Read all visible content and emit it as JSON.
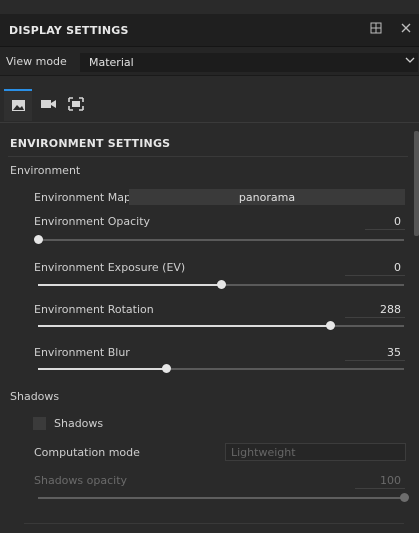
{
  "panel": {
    "title": "DISPLAY SETTINGS"
  },
  "header_icons": [
    "dock-icon",
    "close-icon"
  ],
  "view_mode": {
    "label": "View mode",
    "value": "Material"
  },
  "tabs": [
    {
      "name": "image-icon",
      "active": true
    },
    {
      "name": "video-camera-icon",
      "active": false
    },
    {
      "name": "frame-icon",
      "active": false
    }
  ],
  "environment_settings": {
    "title": "ENVIRONMENT SETTINGS",
    "group_label": "Environment",
    "env_map": {
      "label": "Environment Map",
      "value": "panorama"
    },
    "opacity": {
      "label": "Environment Opacity",
      "value": "0",
      "level": 0.0
    },
    "exposure": {
      "label": "Environment Exposure (EV)",
      "value": "0",
      "level": 0.5
    },
    "rotation": {
      "label": "Environment Rotation",
      "value": "288",
      "level": 0.8
    },
    "blur": {
      "label": "Environment Blur",
      "value": "35",
      "level": 0.35
    }
  },
  "shadows": {
    "group_label": "Shadows",
    "checkbox_label": "Shadows",
    "checked": false,
    "computation_mode": {
      "label": "Computation mode",
      "value": "Lightweight"
    },
    "opacity": {
      "label": "Shadows opacity",
      "value": "100",
      "level": 1.0
    }
  },
  "colors": {
    "accent": "#2a8fe6",
    "background": "#2a2a2a",
    "header": "#1f1f1f"
  }
}
